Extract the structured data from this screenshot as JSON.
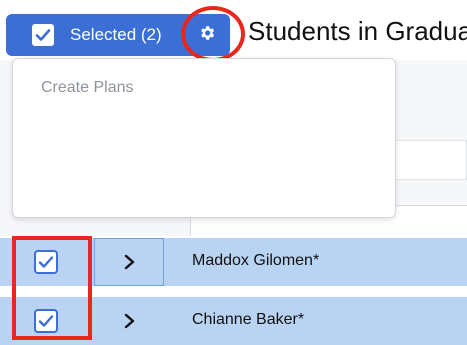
{
  "toolbar": {
    "selected_label": "Selected (2)",
    "settings_icon": "gear-icon",
    "accent_color": "#3b6fd6",
    "highlight_color": "#e8271e"
  },
  "page": {
    "title": "Students in Gradua"
  },
  "dropdown": {
    "items": [
      {
        "label": "Create Plans"
      }
    ]
  },
  "students": [
    {
      "name": "Maddox Gilomen*",
      "selected": true
    },
    {
      "name": "Chianne Baker*",
      "selected": true
    }
  ]
}
